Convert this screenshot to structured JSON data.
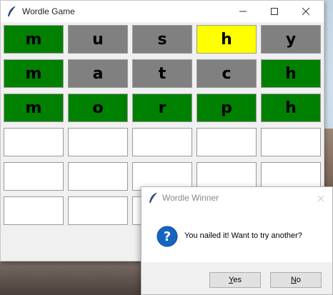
{
  "main_window": {
    "title": "Wordle Game",
    "icon": "feather-icon",
    "controls": {
      "minimize": "minimize-icon",
      "maximize": "maximize-icon",
      "close": "close-icon"
    }
  },
  "colors": {
    "green": "#008000",
    "gray": "#808080",
    "yellow": "#ffff00",
    "empty": "#ffffff"
  },
  "board": {
    "rows": [
      [
        {
          "letter": "m",
          "state": "green"
        },
        {
          "letter": "u",
          "state": "gray"
        },
        {
          "letter": "s",
          "state": "gray"
        },
        {
          "letter": "h",
          "state": "yellow"
        },
        {
          "letter": "y",
          "state": "gray"
        }
      ],
      [
        {
          "letter": "m",
          "state": "green"
        },
        {
          "letter": "a",
          "state": "gray"
        },
        {
          "letter": "t",
          "state": "gray"
        },
        {
          "letter": "c",
          "state": "gray"
        },
        {
          "letter": "h",
          "state": "green"
        }
      ],
      [
        {
          "letter": "m",
          "state": "green"
        },
        {
          "letter": "o",
          "state": "green"
        },
        {
          "letter": "r",
          "state": "green"
        },
        {
          "letter": "p",
          "state": "green"
        },
        {
          "letter": "h",
          "state": "green"
        }
      ],
      [
        {
          "letter": "",
          "state": "empty"
        },
        {
          "letter": "",
          "state": "empty"
        },
        {
          "letter": "",
          "state": "empty"
        },
        {
          "letter": "",
          "state": "empty"
        },
        {
          "letter": "",
          "state": "empty"
        }
      ],
      [
        {
          "letter": "",
          "state": "empty"
        },
        {
          "letter": "",
          "state": "empty"
        },
        {
          "letter": "",
          "state": "empty"
        },
        {
          "letter": "",
          "state": "empty"
        },
        {
          "letter": "",
          "state": "empty"
        }
      ],
      [
        {
          "letter": "",
          "state": "empty"
        },
        {
          "letter": "",
          "state": "empty"
        },
        {
          "letter": "",
          "state": "empty"
        },
        {
          "letter": "",
          "state": "empty"
        },
        {
          "letter": "",
          "state": "empty"
        }
      ]
    ]
  },
  "dialog": {
    "title": "Wordle Winner",
    "icon": "question-icon",
    "message": "You nailed it! Want to try another?",
    "yes_label": "Yes",
    "no_label": "No"
  }
}
